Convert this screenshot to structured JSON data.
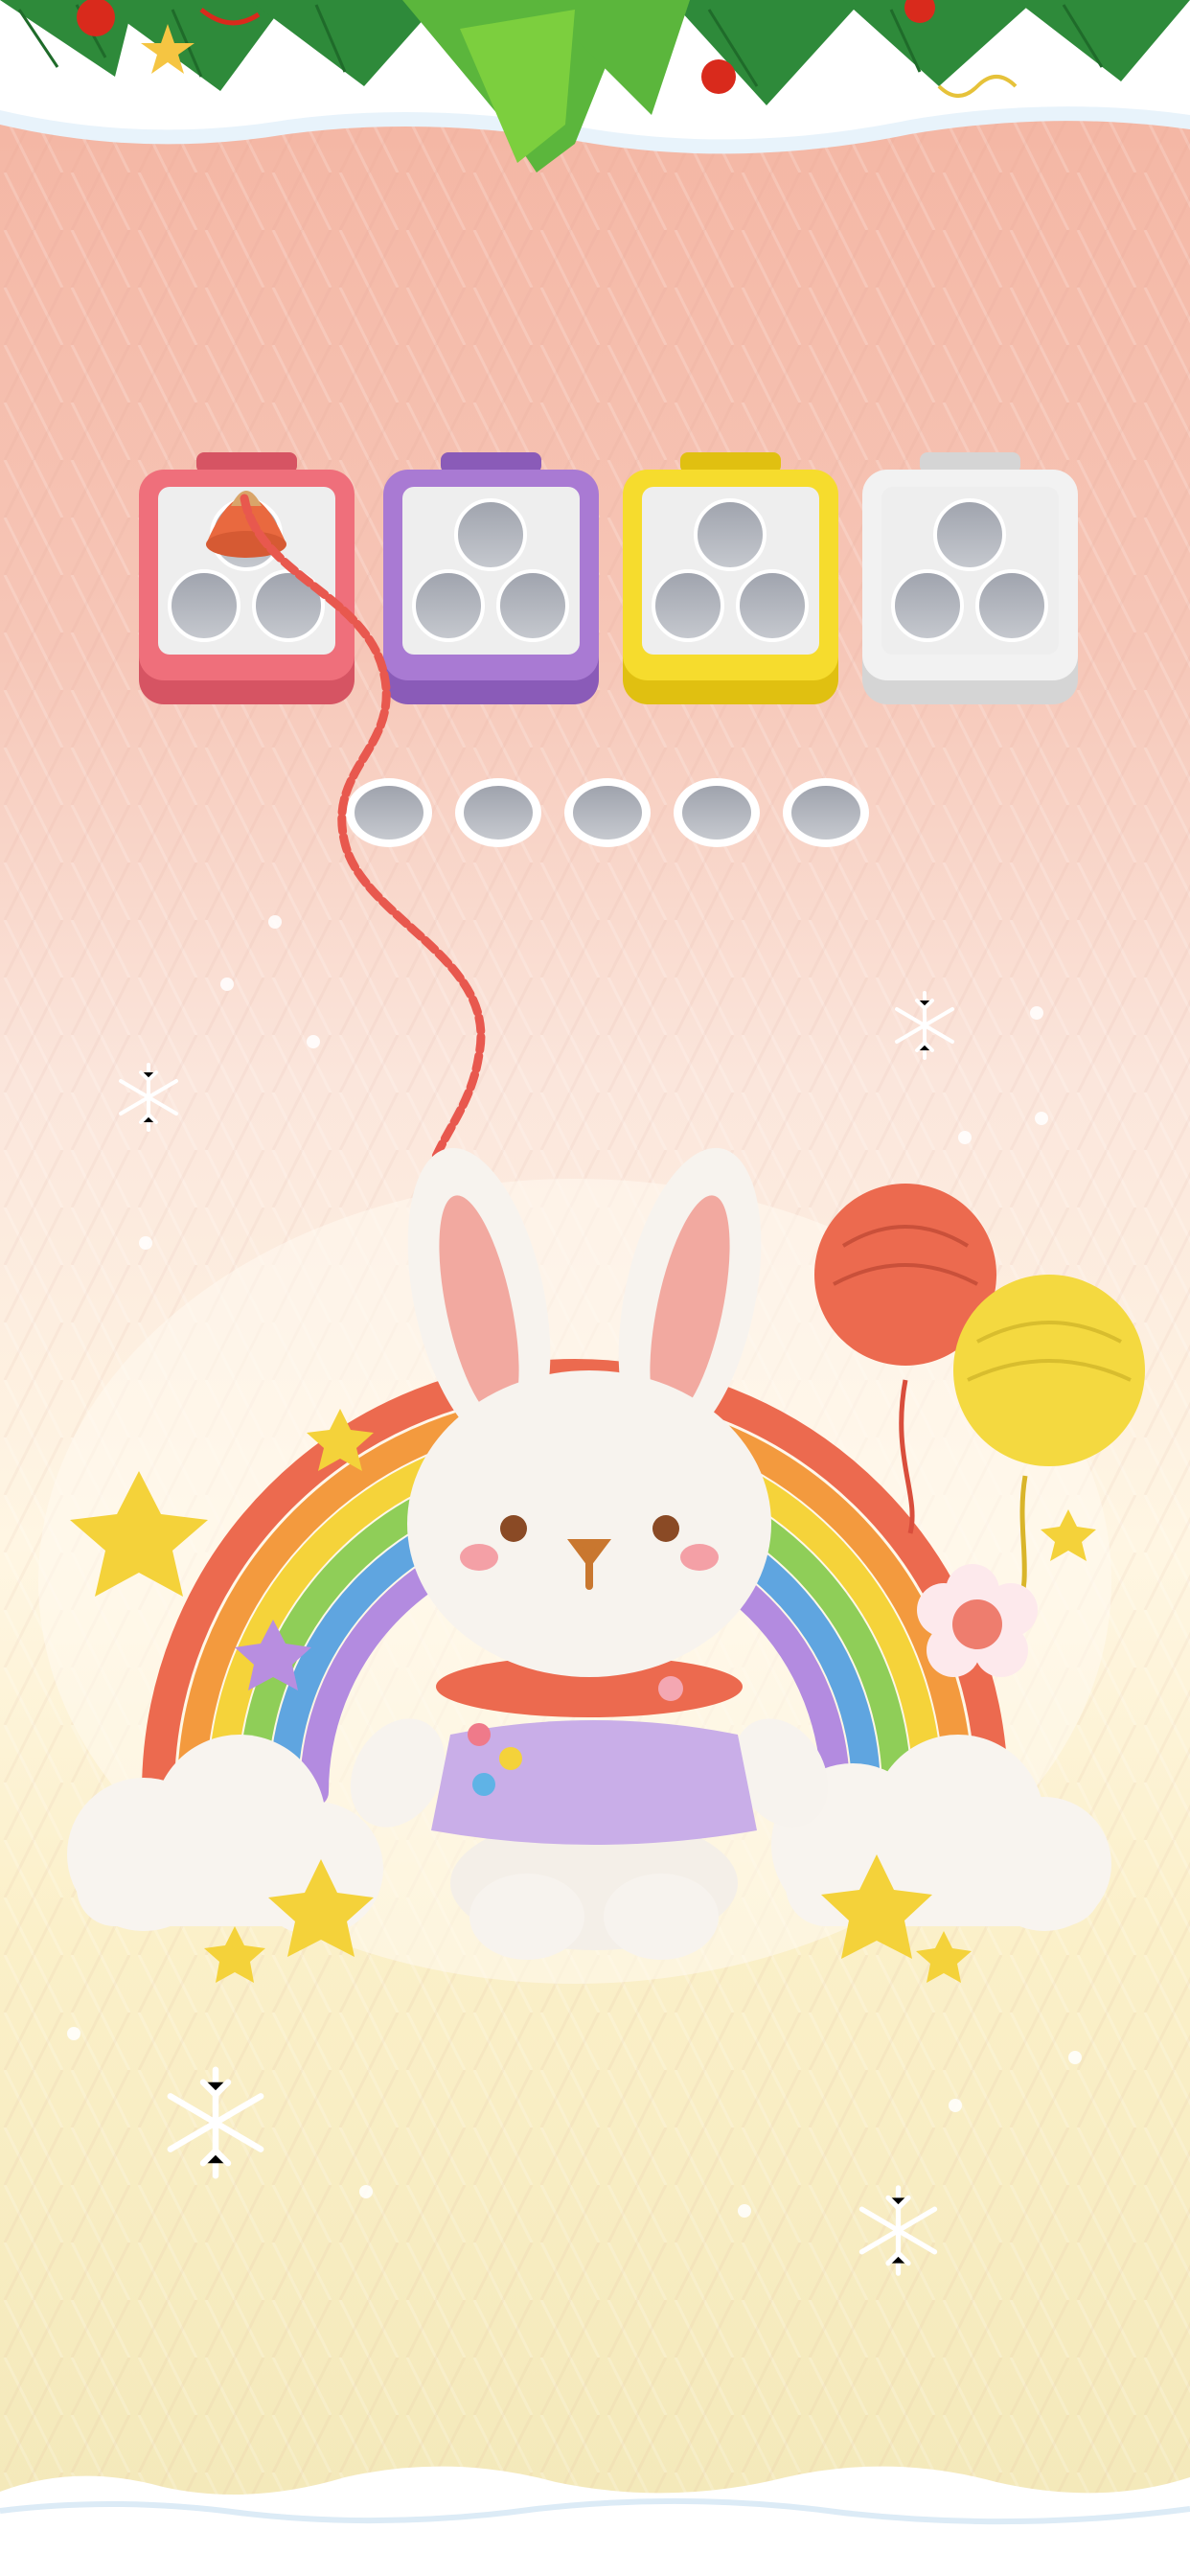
{
  "theme": {
    "bg_top": "#f4b3a0",
    "bg_bottom": "#f3e8b8",
    "snow": "#ffffff"
  },
  "boxes": [
    {
      "name": "box-red",
      "color": "#ef6f7b",
      "dark": "#d65463",
      "filled_slots": 1
    },
    {
      "name": "box-purple",
      "color": "#a97ad3",
      "dark": "#8a5bb8",
      "filled_slots": 0
    },
    {
      "name": "box-yellow",
      "color": "#f6dc2d",
      "dark": "#e0c011",
      "filled_slots": 0
    },
    {
      "name": "box-white",
      "color": "#f2f2f2",
      "dark": "#d5d5d5",
      "filled_slots": 0
    }
  ],
  "box_slots_per_box": 3,
  "holding_slots": 5,
  "yarn_spool": {
    "color": "#e9693f",
    "icon": "yarn-spool-icon"
  },
  "thread_color": "#e8584e",
  "picture": {
    "subject": "knitted-bunny-with-rainbow",
    "icons": [
      "bunny-icon",
      "rainbow-icon",
      "balloon-icon",
      "star-icon",
      "cloud-icon",
      "flower-icon",
      "snowflake-icon"
    ]
  }
}
